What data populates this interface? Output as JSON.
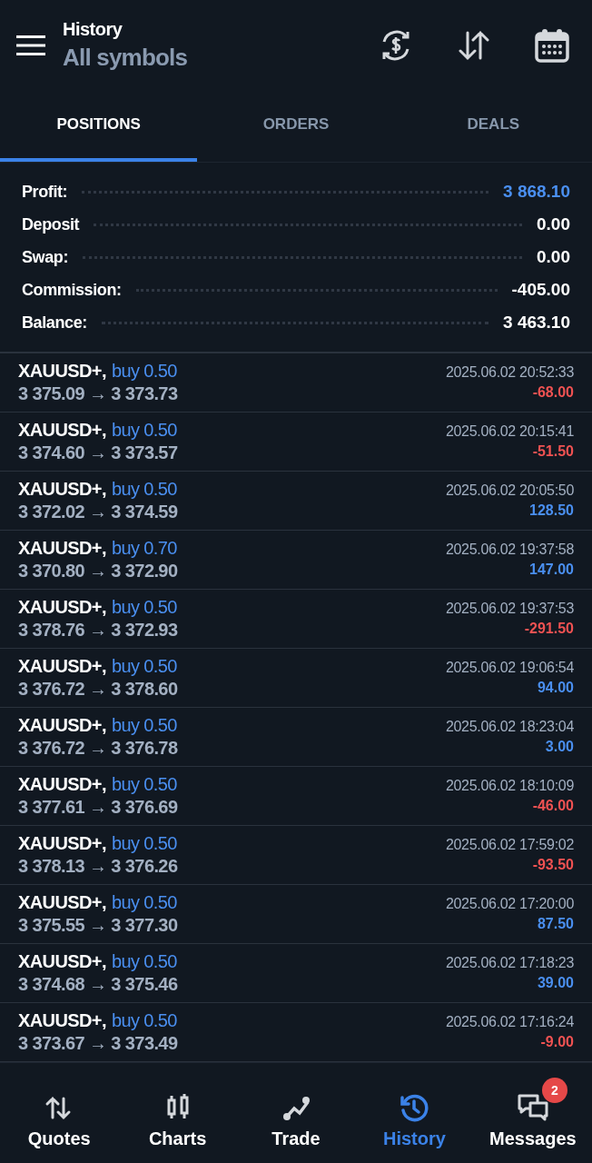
{
  "header": {
    "title": "History",
    "subtitle": "All symbols"
  },
  "tabs": [
    {
      "label": "POSITIONS",
      "selected": true
    },
    {
      "label": "ORDERS",
      "selected": false
    },
    {
      "label": "DEALS",
      "selected": false
    }
  ],
  "summary": [
    {
      "label": "Profit:",
      "value": "3 868.10",
      "highlighted": true
    },
    {
      "label": "Deposit",
      "value": "0.00",
      "highlighted": false
    },
    {
      "label": "Swap:",
      "value": "0.00",
      "highlighted": false
    },
    {
      "label": "Commission:",
      "value": "-405.00",
      "highlighted": false
    },
    {
      "label": "Balance:",
      "value": "3 463.10",
      "highlighted": false
    }
  ],
  "positions": [
    {
      "symbol": "XAUUSD+,",
      "trade": "buy 0.50",
      "prices": "3 375.09 → 3 373.73",
      "time": "2025.06.02 20:52:33",
      "profit": "-68.00",
      "kind": "loss"
    },
    {
      "symbol": "XAUUSD+,",
      "trade": "buy 0.50",
      "prices": "3 374.60 → 3 373.57",
      "time": "2025.06.02 20:15:41",
      "profit": "-51.50",
      "kind": "loss"
    },
    {
      "symbol": "XAUUSD+,",
      "trade": "buy 0.50",
      "prices": "3 372.02 → 3 374.59",
      "time": "2025.06.02 20:05:50",
      "profit": "128.50",
      "kind": "gain"
    },
    {
      "symbol": "XAUUSD+,",
      "trade": "buy 0.70",
      "prices": "3 370.80 → 3 372.90",
      "time": "2025.06.02 19:37:58",
      "profit": "147.00",
      "kind": "gain"
    },
    {
      "symbol": "XAUUSD+,",
      "trade": "buy 0.50",
      "prices": "3 378.76 → 3 372.93",
      "time": "2025.06.02 19:37:53",
      "profit": "-291.50",
      "kind": "loss"
    },
    {
      "symbol": "XAUUSD+,",
      "trade": "buy 0.50",
      "prices": "3 376.72 → 3 378.60",
      "time": "2025.06.02 19:06:54",
      "profit": "94.00",
      "kind": "gain"
    },
    {
      "symbol": "XAUUSD+,",
      "trade": "buy 0.50",
      "prices": "3 376.72 → 3 376.78",
      "time": "2025.06.02 18:23:04",
      "profit": "3.00",
      "kind": "gain"
    },
    {
      "symbol": "XAUUSD+,",
      "trade": "buy 0.50",
      "prices": "3 377.61 → 3 376.69",
      "time": "2025.06.02 18:10:09",
      "profit": "-46.00",
      "kind": "loss"
    },
    {
      "symbol": "XAUUSD+,",
      "trade": "buy 0.50",
      "prices": "3 378.13 → 3 376.26",
      "time": "2025.06.02 17:59:02",
      "profit": "-93.50",
      "kind": "loss"
    },
    {
      "symbol": "XAUUSD+,",
      "trade": "buy 0.50",
      "prices": "3 375.55 → 3 377.30",
      "time": "2025.06.02 17:20:00",
      "profit": "87.50",
      "kind": "gain"
    },
    {
      "symbol": "XAUUSD+,",
      "trade": "buy 0.50",
      "prices": "3 374.68 → 3 375.46",
      "time": "2025.06.02 17:18:23",
      "profit": "39.00",
      "kind": "gain"
    },
    {
      "symbol": "XAUUSD+,",
      "trade": "buy 0.50",
      "prices": "3 373.67 → 3 373.49",
      "time": "2025.06.02 17:16:24",
      "profit": "-9.00",
      "kind": "loss"
    }
  ],
  "nav": [
    {
      "label": "Quotes",
      "kind": "quotes",
      "selected": false
    },
    {
      "label": "Charts",
      "kind": "charts",
      "selected": false
    },
    {
      "label": "Trade",
      "kind": "trade",
      "selected": false
    },
    {
      "label": "History",
      "kind": "history",
      "selected": true
    },
    {
      "label": "Messages",
      "kind": "messages",
      "selected": false,
      "badge": "2"
    }
  ]
}
